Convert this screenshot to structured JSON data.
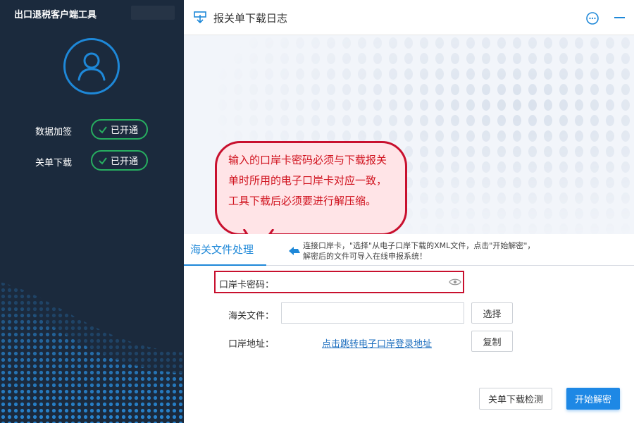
{
  "app": {
    "title": "出口退税客户端工具"
  },
  "sidebar": {
    "items": [
      {
        "label": "数据加签",
        "status": "已开通"
      },
      {
        "label": "关单下载",
        "status": "已开通"
      }
    ]
  },
  "header": {
    "title": "报关单下载日志"
  },
  "callout": {
    "text": "输入的口岸卡密码必须与下载报关单时所用的电子口岸卡对应一致，工具下载后必须要进行解压缩。"
  },
  "tabs": [
    {
      "label": "海关文件处理",
      "active": true
    }
  ],
  "hint": {
    "line1": "连接口岸卡，\"选择\"从电子口岸下载的XML文件，点击\"开始解密\"，",
    "line2": "解密后的文件可导入在线申报系统！"
  },
  "form": {
    "password": {
      "label": "口岸卡密码：",
      "value": ""
    },
    "file": {
      "label": "海关文件：",
      "value": "",
      "button": "选择"
    },
    "address": {
      "label": "口岸地址：",
      "link": "点击跳转电子口岸登录地址",
      "button": "复制"
    }
  },
  "actions": {
    "check": "关单下载检测",
    "decrypt": "开始解密"
  },
  "colors": {
    "sidebar": "#1b2a3d",
    "accent": "#1e88d8",
    "success": "#27ae60",
    "warning": "#c8102e"
  }
}
